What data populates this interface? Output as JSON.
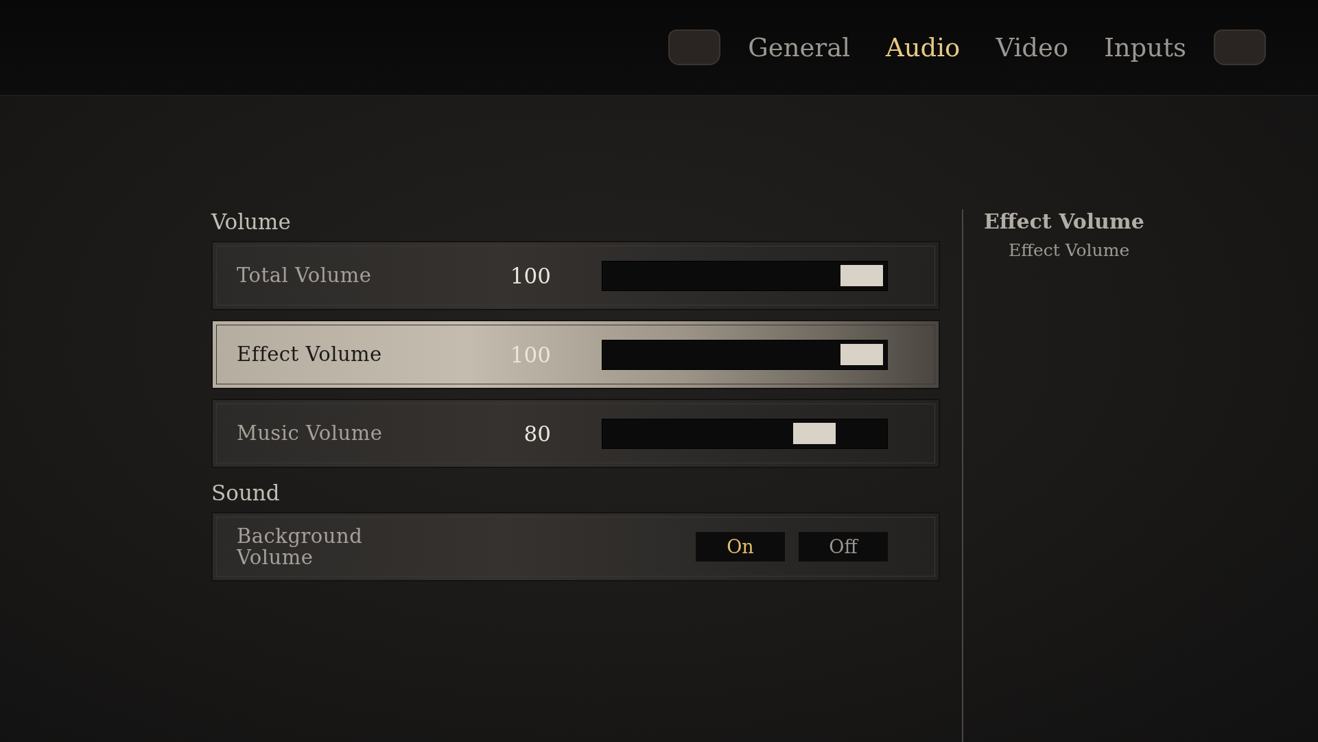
{
  "tabs": [
    {
      "label": "General",
      "selected": false
    },
    {
      "label": "Audio",
      "selected": true
    },
    {
      "label": "Video",
      "selected": false
    },
    {
      "label": "Inputs",
      "selected": false
    }
  ],
  "sections": [
    {
      "title": "Volume",
      "rows": [
        {
          "kind": "slider",
          "label": "Total Volume",
          "value": "100",
          "level": 1,
          "selected": false
        },
        {
          "kind": "slider",
          "label": "Effect Volume",
          "value": "100",
          "level": 1,
          "selected": true
        },
        {
          "kind": "slider",
          "label": "Music Volume",
          "value": "80",
          "level": 0.8,
          "selected": false
        }
      ]
    },
    {
      "title": "Sound",
      "rows": [
        {
          "kind": "toggle",
          "label": "Background Volume",
          "selected": false,
          "options": [
            {
              "label": "On",
              "selected": true
            },
            {
              "label": "Off",
              "selected": false
            }
          ]
        }
      ]
    }
  ],
  "detail": {
    "title": "Effect Volume",
    "description": "Effect Volume"
  }
}
